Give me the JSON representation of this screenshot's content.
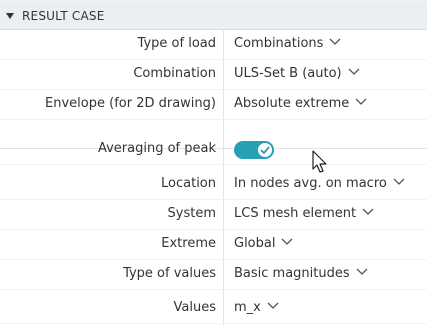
{
  "panel": {
    "section_title": "RESULT CASE",
    "rows": [
      {
        "label": "Type of load",
        "value": "Combinations"
      },
      {
        "label": "Combination",
        "value": "ULS-Set B (auto)"
      },
      {
        "label": "Envelope (for 2D drawing)",
        "value": "Absolute extreme"
      },
      {
        "label": "Averaging of peak",
        "toggle_on": true
      },
      {
        "label": "Location",
        "value": "In nodes avg. on macro"
      },
      {
        "label": "System",
        "value": "LCS mesh element"
      },
      {
        "label": "Extreme",
        "value": "Global"
      },
      {
        "label": "Type of values",
        "value": "Basic magnitudes"
      },
      {
        "label": "Values",
        "value": "m_x"
      }
    ]
  },
  "icons": {
    "collapse": "triangle-down-icon",
    "dropdown": "chevron-down-icon",
    "toggle_check": "check-icon",
    "cursor": "mouse-pointer-icon"
  },
  "colors": {
    "toggle_accent": "#27a0b4",
    "header_bg": "#eceff1",
    "text": "#333333"
  }
}
